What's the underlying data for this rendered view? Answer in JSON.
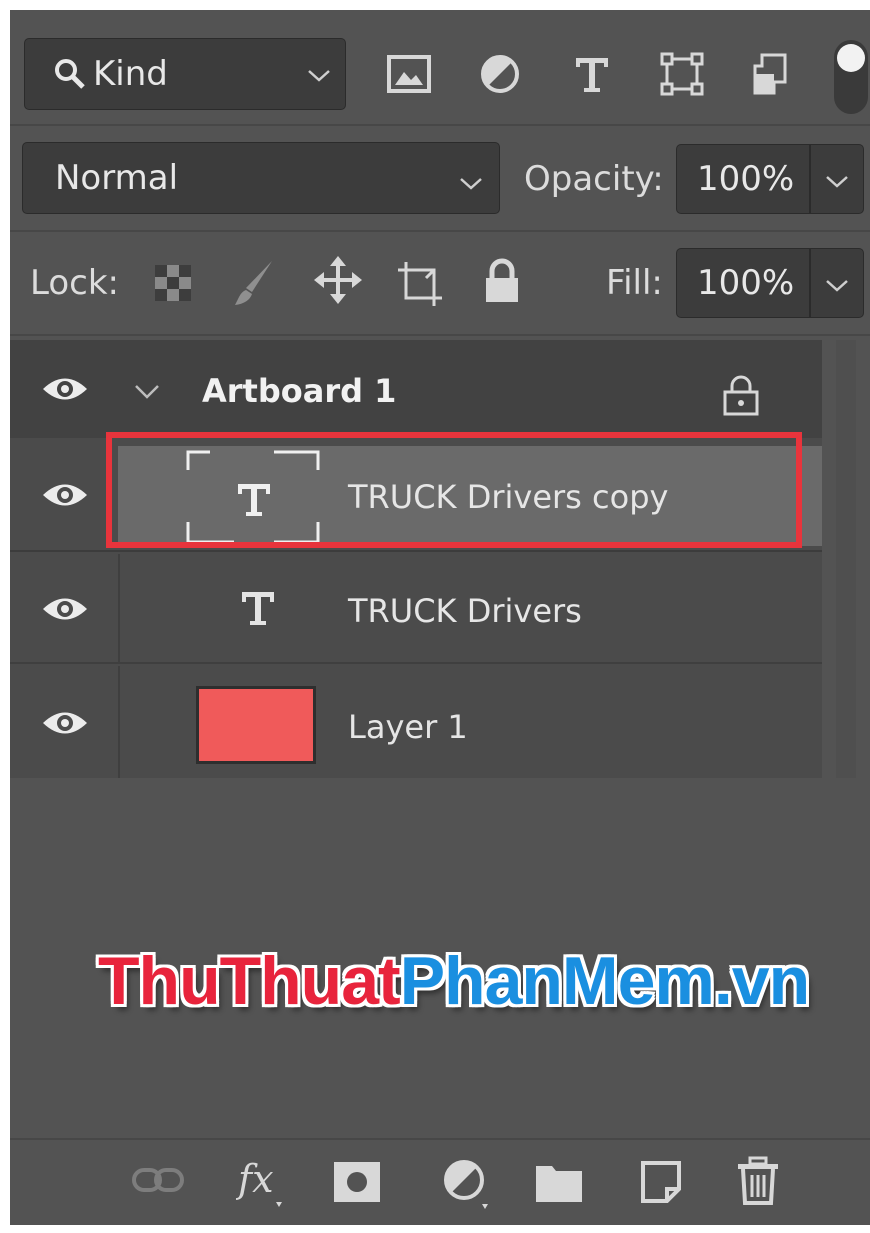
{
  "filter": {
    "kind_label": "Kind",
    "icons": [
      "image-filter-icon",
      "adjustment-filter-icon",
      "type-filter-icon",
      "shape-filter-icon",
      "smart-object-filter-icon"
    ]
  },
  "blend": {
    "mode": "Normal",
    "opacity_label": "Opacity:",
    "opacity_value": "100%"
  },
  "lock": {
    "label": "Lock:",
    "fill_label": "Fill:",
    "fill_value": "100%"
  },
  "layers": {
    "artboard_name": "Artboard 1",
    "items": [
      {
        "name": "TRUCK Drivers copy",
        "type": "text",
        "selected": true
      },
      {
        "name": "TRUCK Drivers",
        "type": "text",
        "selected": false
      },
      {
        "name": "Layer 1",
        "type": "pixel",
        "selected": false,
        "thumb_color": "#f05a5a"
      }
    ]
  },
  "watermark": {
    "part1": "ThuThuat",
    "part2": "PhanMem",
    "part3": ".vn",
    "color1": "#e8243c",
    "color2": "#1a8fe0"
  },
  "colors": {
    "panel": "#535353",
    "highlight": "#e8343c",
    "selected_row": "#6a6a6a"
  }
}
